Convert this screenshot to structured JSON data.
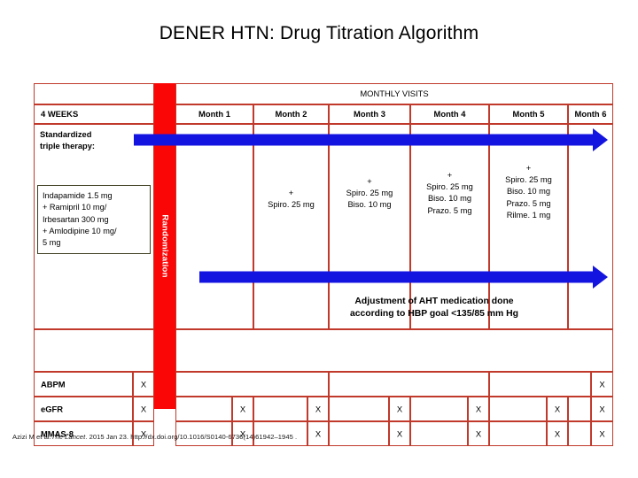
{
  "title": "DENER HTN: Drug Titration Algorithm",
  "colors": {
    "table_border": "#c0392b",
    "randomization_bar": "#fb0606",
    "arrow": "#1414e0",
    "drugbox_border": "#3f3f22"
  },
  "table": {
    "monthly_visits_header": "MONTHLY VISITS",
    "interval_label": "4 WEEKS",
    "months": [
      {
        "label": "Month 1"
      },
      {
        "label": "Month 2"
      },
      {
        "label": "Month 3"
      },
      {
        "label": "Month 4"
      },
      {
        "label": "Month 5"
      },
      {
        "label": "Month 6"
      }
    ]
  },
  "left_column": {
    "heading": "Standardized\ntriple therapy:",
    "heading_line1": "Standardized",
    "heading_line2": "triple therapy:",
    "drug_box": {
      "line1": "Indapamide 1.5 mg",
      "line2": "+ Ramipril 10 mg/",
      "line3": "Irbesartan 300 mg",
      "line4": "+ Amlodipine 10 mg/",
      "line5": "5 mg"
    }
  },
  "randomization": {
    "label": "Randomization"
  },
  "titration": {
    "month1": "",
    "month2": {
      "plus": "+",
      "l1": "Spiro. 25 mg"
    },
    "month3": {
      "plus": "+",
      "l1": "Spiro. 25 mg",
      "l2": "Biso. 10 mg"
    },
    "month4": {
      "plus": "+",
      "l1": "Spiro. 25 mg",
      "l2": "Biso. 10 mg",
      "l3": "Prazo. 5 mg"
    },
    "month5": {
      "plus": "+",
      "l1": "Spiro. 25 mg",
      "l2": "Biso. 10 mg",
      "l3": "Prazo. 5 mg",
      "l4": "Rilme. 1 mg"
    },
    "month6": ""
  },
  "adjustment_note": {
    "line1": "Adjustment of AHT medication done",
    "line2": "according to HBP goal <135/85 mm Hg"
  },
  "assessment_rows": [
    {
      "label": "ABPM",
      "marks": [
        "X",
        "",
        "",
        "",
        "",
        "",
        "X"
      ]
    },
    {
      "label": "eGFR",
      "marks": [
        "X",
        "X",
        "X",
        "X",
        "X",
        "X",
        "X"
      ]
    },
    {
      "label": "MMAS-8",
      "marks": [
        "X",
        "X",
        "X",
        "X",
        "X",
        "X",
        "X"
      ]
    }
  ],
  "mark_symbol": "X",
  "citation": {
    "authors": "Azizi M et al.",
    "journal": "The Lancet",
    "rest": ". 2015 Jan 23. http://dx.doi.org/10.1016/S0140-6736(14)61942–1945 ."
  }
}
